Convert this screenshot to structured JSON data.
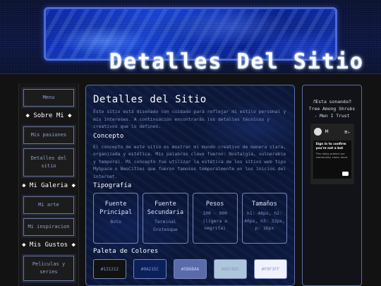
{
  "header": {
    "title": "Detalles Del Sitio"
  },
  "sidebar": {
    "items": [
      {
        "type": "button",
        "label": "Menu"
      },
      {
        "type": "heading",
        "label": "◆ Sobre Mi ◆"
      },
      {
        "type": "button",
        "label": "Mis pasiones"
      },
      {
        "type": "button",
        "label": "Detalles del sitio"
      },
      {
        "type": "heading",
        "label": "◆ Mi Galeria ◆"
      },
      {
        "type": "button",
        "label": "Mi arte"
      },
      {
        "type": "button",
        "label": "Mi inspiracion"
      },
      {
        "type": "heading",
        "label": "◆ Mis Gustos ◆"
      },
      {
        "type": "button",
        "label": "Peliculas y series"
      }
    ]
  },
  "main": {
    "title": "Detalles del Sitio",
    "intro": "Este sitio está diseñado con cuidado para reflejar mi estilo personal y mis intereses. A continuación encontrarás los detalles técnicos y creativos que lo definen.",
    "concept": {
      "heading": "Concepto",
      "text": "El concepto de este sitio es mostrar mi mundo creativo de manera clara, organizada y estética. Mis palabras clave fueron: Nostalgia, vulnerable y temporal. Mi concepto fue utilizar la estética de los sitios web tipo MySpace o NeoCities que fueron famosos temporalmente en los inicios del internet."
    },
    "typography": {
      "heading": "Tipografía",
      "cards": [
        {
          "title": "Fuente Principal",
          "desc": "Boto"
        },
        {
          "title": "Fuente Secundaria",
          "desc": "Terminal Grotesque"
        },
        {
          "title": "Pesos",
          "desc": "100 - 900 (ligera a negrita)"
        },
        {
          "title": "Tamaños",
          "desc": "h1: 48px, h2: 40px, h3: 32px, p: 16px"
        }
      ]
    },
    "palette": {
      "heading": "Paleta de Colores",
      "colors": [
        {
          "hex": "#121212",
          "label": "#121212",
          "text": "#8a9bc8"
        },
        {
          "hex": "#0A215C",
          "label": "#0A215C",
          "text": "#8a9bc8"
        },
        {
          "hex": "#5B6BAA",
          "label": "#5B6BAA",
          "text": "#c8d2f0"
        },
        {
          "hex": "#AEC6DC",
          "label": "#AEC6DC",
          "text": "#8796b6"
        },
        {
          "hex": "#F0F3FF",
          "label": "#F0F3FF",
          "text": "#8a96c0"
        }
      ]
    }
  },
  "right_panel": {
    "music_line1": "♬Esta sonando♬",
    "music_line2": "Tree Among Shrubs - Men I Trust",
    "embed": {
      "channel_letter": "M",
      "queue_icon": "≡₊",
      "heading": "Sign in to confirm you're not a bot",
      "subtext": "This helps protect our community. Learn more"
    }
  }
}
